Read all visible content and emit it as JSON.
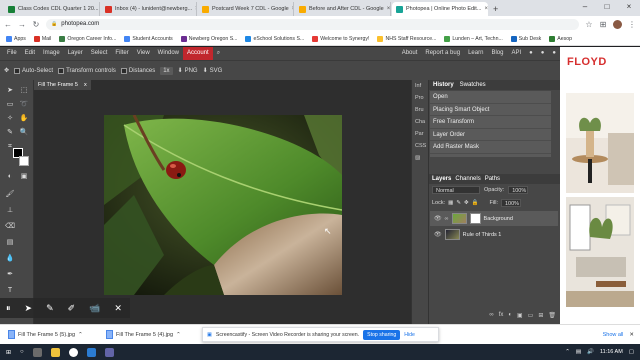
{
  "browser": {
    "tabs": [
      {
        "title": "Class Codes CDL Quarter 1 20...",
        "color": "#188038"
      },
      {
        "title": "Inbox (4) - lunident@newberg...",
        "color": "#d93025"
      },
      {
        "title": "Postcard Week 7 CDL - Google",
        "color": "#f9ab00"
      },
      {
        "title": "Before and After CDL - Google",
        "color": "#f9ab00"
      },
      {
        "title": "Photopea | Online Photo Edit...",
        "color": "#18a497"
      }
    ],
    "new_tab": "+",
    "url": "photopea.com",
    "bookmarks": [
      "Apps",
      "Mail",
      "Oregon Career Info...",
      "Student Accounts",
      "Newberg Oregon S...",
      "eSchool Solutions S...",
      "Welcome to Synergy!",
      "NHS Staff Resource...",
      "Lunden – Art, Techn...",
      "Sub Desk",
      "Aesop"
    ]
  },
  "menubar": {
    "items": [
      "File",
      "Edit",
      "Image",
      "Layer",
      "Select",
      "Filter",
      "View",
      "Window",
      "Account"
    ],
    "right": [
      "About",
      "Report a bug",
      "Learn",
      "Blog",
      "API"
    ]
  },
  "options": {
    "auto_select": "Auto-Select",
    "transform_controls": "Transform controls",
    "distances": "Distances",
    "zoom": "1x",
    "png": "PNG",
    "svg": "SVG"
  },
  "document": {
    "tab_title": "Fill The Frame 5",
    "close": "x"
  },
  "midcol": [
    "Inf",
    "Pro",
    "Bru",
    "Cha",
    "Par",
    "CSS"
  ],
  "history": {
    "tabs": [
      "History",
      "Swatches"
    ],
    "items": [
      "Open",
      "Placing Smart Object",
      "Free Transform",
      "Layer Order",
      "Add Raster Mask"
    ]
  },
  "layers": {
    "tabs": [
      "Layers",
      "Channels",
      "Paths"
    ],
    "blend_mode": "Normal",
    "opacity_label": "Opacity:",
    "opacity": "100%",
    "lock_label": "Lock:",
    "fill_label": "Fill:",
    "fill": "100%",
    "items": [
      {
        "name": "Background"
      },
      {
        "name": "Rule of Thirds 1"
      }
    ]
  },
  "ad": {
    "brand": "FLOYD"
  },
  "downloads": {
    "items": [
      "Fill The Frame 5 (5).jpg",
      "Fill The Frame 5 (4).jpg"
    ],
    "show_all": "Show all"
  },
  "notification": {
    "text": "Screencastify - Screen Video Recorder is sharing your screen.",
    "stop": "Stop sharing",
    "hide": "Hide"
  },
  "taskbar": {
    "time": "11:16 AM"
  }
}
